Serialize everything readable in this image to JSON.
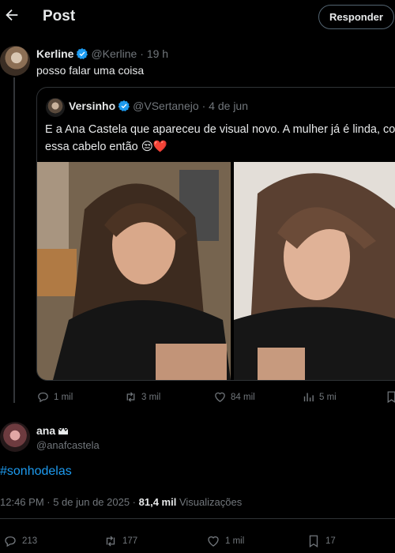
{
  "header": {
    "back_icon": "arrow-left-icon",
    "title": "Post",
    "reply_label": "Responder"
  },
  "reply_post": {
    "display_name": "Kerline",
    "handle": "@Kerline",
    "time": "· 19 h",
    "text": "posso falar uma coisa",
    "verified": true
  },
  "quoted_post": {
    "display_name": "Versinho",
    "handle": "@VSertanejo",
    "time": "· 4 de jun",
    "text_line1": "E a Ana Castela que apareceu de visual novo. A mulher já é linda, co",
    "text_line2": "essa cabelo então",
    "emojis": "😒❤️",
    "verified": true,
    "photos": [
      "photo-1",
      "photo-2"
    ],
    "actions": {
      "replies": "1 mil",
      "reposts": "3 mil",
      "likes": "84 mil",
      "views": "5 mi"
    }
  },
  "main_post": {
    "display_name": "ana",
    "badge_icon": "crown-icon",
    "handle": "@anafcastela",
    "hashtag": "#sonhodelas",
    "timestamp": "12:46 PM · 5 de jun de 2025 ·",
    "views_count": "81,4 mil",
    "views_label": "Visualizações",
    "actions": {
      "replies": "213",
      "reposts": "177",
      "likes": "1 mil",
      "bookmarks": "17"
    }
  },
  "colors": {
    "background": "#000000",
    "text": "#e7e9ea",
    "muted": "#71767b",
    "accent": "#1d9bf0",
    "border": "#2f3336"
  }
}
